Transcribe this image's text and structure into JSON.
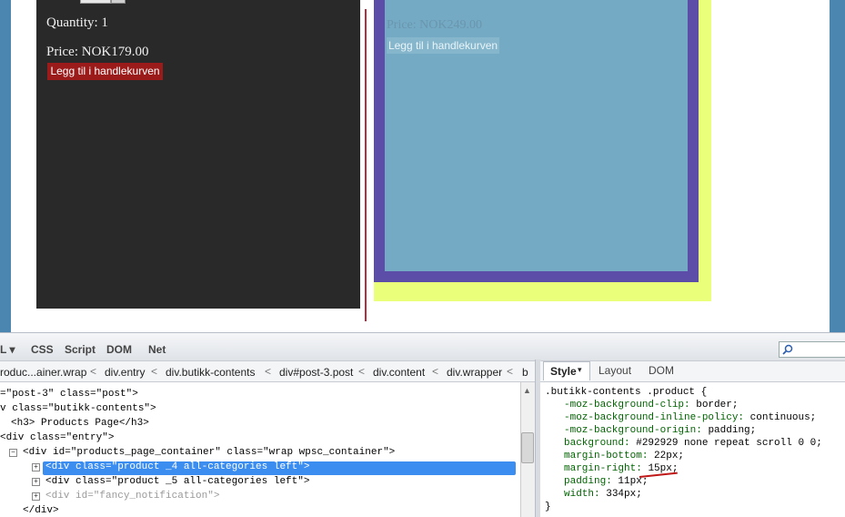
{
  "page": {
    "product4": {
      "quantity_label": "Quantity:",
      "quantity_value": "1",
      "price": "Price: NOK179.00",
      "add_to_cart": "Legg til i handlekurven"
    },
    "product5": {
      "price": "Price: NOK249.00",
      "add_to_cart": "Legg til i handlekurven"
    }
  },
  "devtools": {
    "tabs": {
      "html": "L",
      "css": "CSS",
      "script": "Script",
      "dom": "DOM",
      "net": "Net"
    },
    "breadcrumbs": [
      "roduc...ainer.wrap",
      "div.entry",
      "div.butikk-contents",
      "div#post-3.post",
      "div.content",
      "div.wrapper",
      "b"
    ],
    "side_tabs": {
      "style": "Style",
      "layout": "Layout",
      "dom": "DOM"
    },
    "html_lines": [
      "=\"post-3\" class=\"post\">",
      "v class=\"butikk-contents\">",
      "<h3> Products Page</h3>",
      "<div class=\"entry\">",
      "<div id=\"products_page_container\" class=\"wrap wpsc_container\">",
      "<div class=\"product _4 all-categories left\">",
      "<div class=\"product _5 all-categories left\">",
      "<div id=\"fancy_notification\">",
      "</div>"
    ],
    "css_rule": {
      "selector": ".butikk-contents .product {",
      "declarations": [
        {
          "prop": "-moz-background-clip:",
          "value": "border;"
        },
        {
          "prop": "-moz-background-inline-policy:",
          "value": "continuous;"
        },
        {
          "prop": "-moz-background-origin:",
          "value": "padding;"
        },
        {
          "prop": "background:",
          "value": "#292929 none repeat scroll 0 0;"
        },
        {
          "prop": "margin-bottom:",
          "value": "22px;"
        },
        {
          "prop": "margin-right:",
          "value": "15px;"
        },
        {
          "prop": "padding:",
          "value": "11px;"
        },
        {
          "prop": "width:",
          "value": "334px;"
        }
      ],
      "close": "}"
    }
  },
  "colors": {
    "product4_bg": "#292929",
    "cart_button": "#9b1b1b",
    "highlight": "#3b8df0"
  }
}
